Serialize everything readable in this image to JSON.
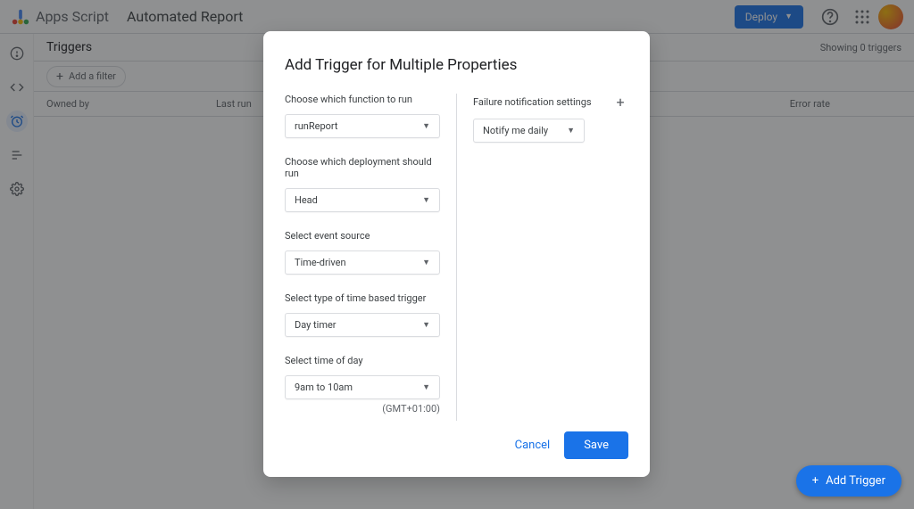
{
  "header": {
    "brand": "Apps Script",
    "project": "Automated Report",
    "deploy": "Deploy"
  },
  "page": {
    "title": "Triggers",
    "showing": "Showing 0 triggers",
    "addFilter": "Add a filter",
    "columns": {
      "owned": "Owned by",
      "lastRun": "Last run",
      "errorRate": "Error rate"
    }
  },
  "modal": {
    "title": "Add Trigger for Multiple Properties",
    "labels": {
      "function": "Choose which function to run",
      "deployment": "Choose which deployment should run",
      "source": "Select event source",
      "type": "Select type of time based trigger",
      "time": "Select time of day",
      "failure": "Failure notification settings"
    },
    "values": {
      "function": "runReport",
      "deployment": "Head",
      "source": "Time-driven",
      "type": "Day timer",
      "time": "9am to 10am",
      "failure": "Notify me daily"
    },
    "tz": "(GMT+01:00)",
    "cancel": "Cancel",
    "save": "Save"
  },
  "fab": "Add Trigger"
}
